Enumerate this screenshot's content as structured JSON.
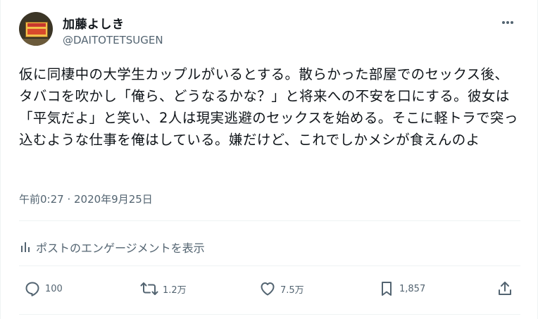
{
  "author": {
    "display_name": "加藤よしき",
    "handle": "@DAITOTETSUGEN",
    "avatar_sign_text": "ビデオルーム 試写室"
  },
  "tweet": {
    "text": "仮に同棲中の大学生カップルがいるとする。散らかった部屋でのセックス後、タバコを吹かし「俺ら、どうなるかな？」と将来への不安を口にする。彼女は「平気だよ」と笑い、2人は現実逃避のセックスを始める。そこに軽トラで突っ込むような仕事を俺はしている。嫌だけど、これでしかメシが食えんのよ",
    "timestamp": "午前0:27 · 2020年9月25日"
  },
  "engagement_link": "ポストのエンゲージメントを表示",
  "actions": {
    "replies": "100",
    "reposts": "1.2万",
    "likes": "7.5万",
    "bookmarks": "1,857"
  },
  "icons": {
    "more": "more-horizontal-icon",
    "analytics": "bar-chart-icon",
    "reply": "reply-bubble-icon",
    "repost": "repost-arrows-icon",
    "like": "heart-icon",
    "bookmark": "bookmark-icon",
    "share": "share-upload-icon"
  },
  "colors": {
    "text_primary": "#0f1419",
    "text_secondary": "#536471",
    "divider": "#eff3f4"
  }
}
